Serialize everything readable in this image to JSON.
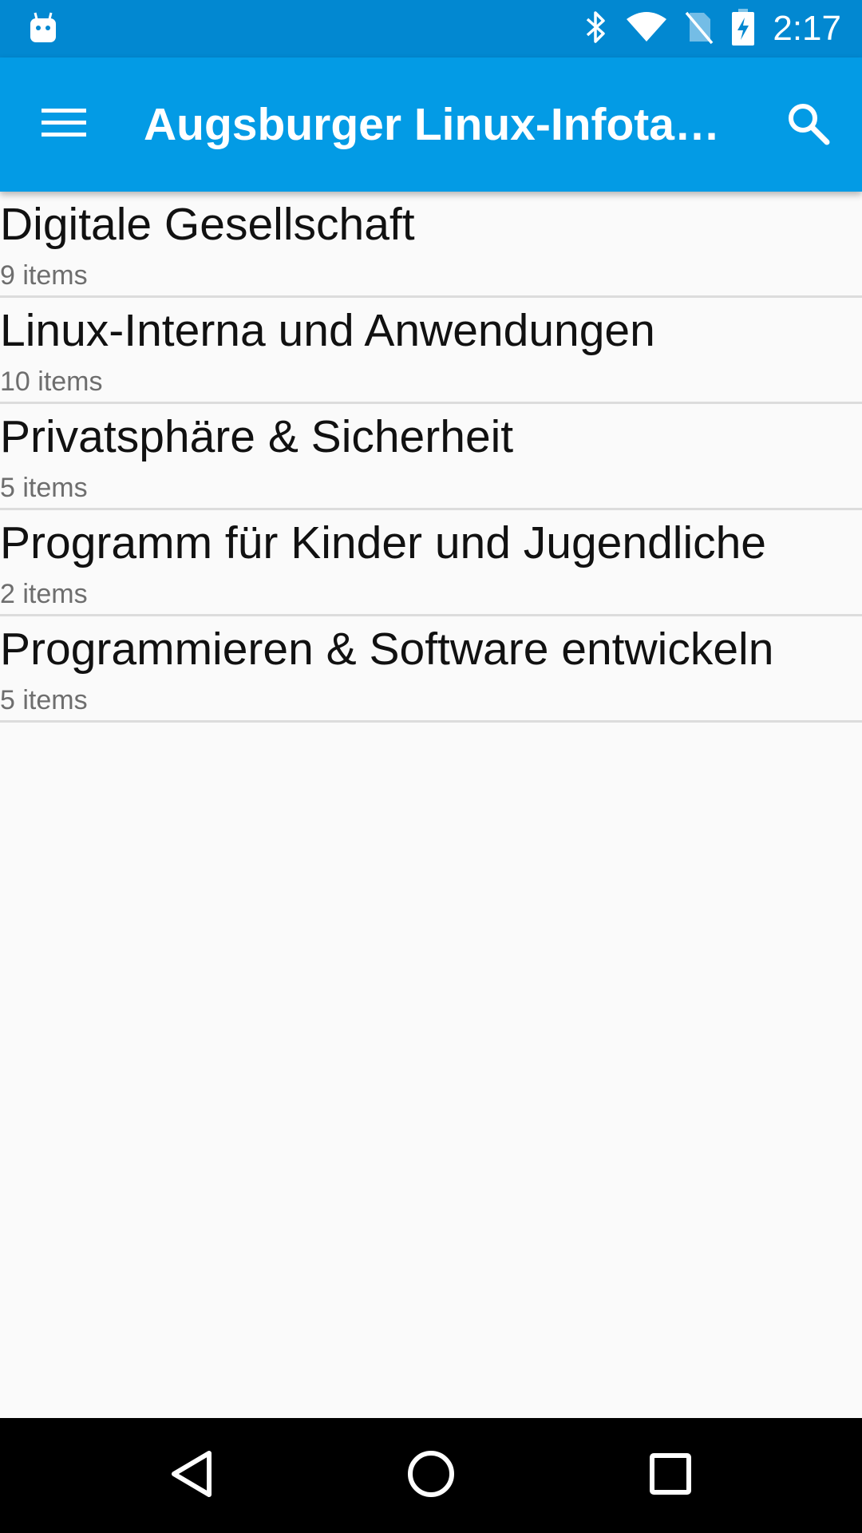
{
  "status_bar": {
    "time": "2:17",
    "icons": [
      "android-debug-icon",
      "bluetooth-icon",
      "wifi-icon",
      "no-sim-icon",
      "battery-charging-icon"
    ],
    "color": "#0288d1"
  },
  "app_bar": {
    "title": "Augsburger Linux-Infotag…",
    "menu_icon": "menu-icon",
    "search_icon": "search-icon",
    "color": "#039be5"
  },
  "tracks": [
    {
      "title": "Digitale Gesellschaft",
      "count": "9 items"
    },
    {
      "title": "Linux-Interna und Anwendungen",
      "count": "10 items"
    },
    {
      "title": "Privatsphäre & Sicherheit",
      "count": "5 items"
    },
    {
      "title": "Programm für Kinder und Jugendliche",
      "count": "2 items"
    },
    {
      "title": "Programmieren & Software entwickeln",
      "count": "5 items"
    }
  ],
  "nav_bar": {
    "icons": [
      "back-icon",
      "home-icon",
      "recents-icon"
    ]
  }
}
